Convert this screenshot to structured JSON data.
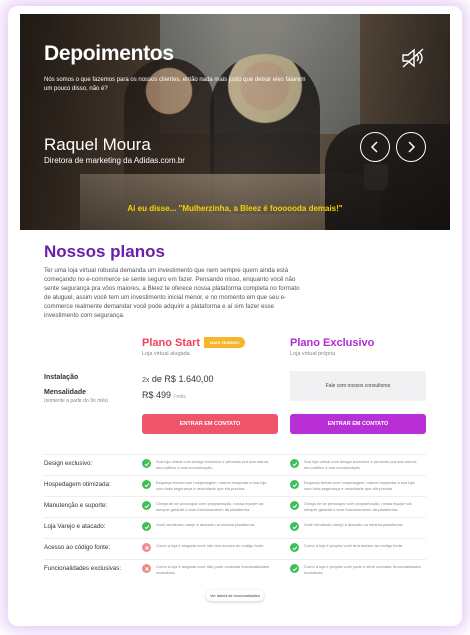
{
  "hero": {
    "title": "Depoimentos",
    "subtitle": "Nós somos o que fazemos para os nossos clientes, então nada mais justo que deixar eles falarem um pouco disso, não é?",
    "author_name": "Raquel Moura",
    "author_role": "Diretora de marketing da Adidas.com.br",
    "quote": "Ai eu disse... \"Mulherzinha, a Bleez é foooooda demais!\"",
    "icons": {
      "mute": "speaker-muted-icon",
      "prev": "chevron-left-icon",
      "next": "chevron-right-icon"
    }
  },
  "plans": {
    "title": "Nossos planos",
    "description": "Ter uma loja virtual robusta demanda um investimento que nem sempre quem ainda está começando no e-commerce se sente seguro em fazer. Pensando nisso, enquanto você não sente segurança pra vôos maiores, a Bleez te oferece nossa plataforma completa no formato de aluguel, assim você tem um investimento inicial menor, e no momento em que seu e-commerce realmente demandar você pode adquirir a plataforma e aí sim fazer esse investimento com segurança.",
    "start": {
      "name": "Plano Start",
      "badge": "MAIS VENDIDO",
      "tag": "Loja virtual alugada",
      "setup_multiplier": "2x",
      "setup_price": "de R$ 1.640,00",
      "monthly_price": "R$ 499",
      "monthly_unit": "/ mês",
      "cta": "ENTRAR EM CONTATO"
    },
    "exclusive": {
      "name": "Plano Exclusivo",
      "tag": "Loja virtual própria",
      "contact_note": "Fale com nossos consultores",
      "cta": "ENTRAR EM CONTATO"
    },
    "labels": {
      "setup": "Instalação",
      "monthly": "Mensalidade",
      "monthly_note": "(somente a partir do 3o mês)"
    },
    "features": [
      {
        "label": "Design exclusivo:",
        "start_ok": true,
        "start_text": "Sua loja virtual com design exclusivo e pensado pra sua marca, seu público e sua comunicação.",
        "excl_ok": true,
        "excl_text": "Sua loja virtual com design exclusivo e pensado pra sua marca, seu público e sua comunicação."
      },
      {
        "label": "Hospedagem otimizada:",
        "start_ok": true,
        "start_text": "Esqueça temas com hospedagem, vamos hospedar a sua loja com toda segurança e velocidade que ela precisa.",
        "excl_ok": true,
        "excl_text": "Esqueça temas com hospedagem, vamos hospedar a sua loja com toda segurança e velocidade que ela precisa."
      },
      {
        "label": "Manutenção e suporte:",
        "start_ok": true,
        "start_text": "Chega de se preocupar com programação, nossa equipe vai sempre garantir o bom funcionamento da plataforma.",
        "excl_ok": true,
        "excl_text": "Chega de se preocupar com programação, nossa equipe vai sempre garantir o bom funcionamento da plataforma."
      },
      {
        "label": "Loja Varejo e atacado:",
        "start_ok": true,
        "start_text": "Você vendendo varejo e atacado na mesma plataforma.",
        "excl_ok": true,
        "excl_text": "Você vendendo varejo e atacado na mesma plataforma."
      },
      {
        "label": "Acesso ao código fonte:",
        "start_ok": false,
        "start_text": "Como a loja é alugada você não tem acesso ao código fonte.",
        "excl_ok": true,
        "excl_text": "Como a loja é própria você terá acesso ao código fonte.",
        "excl_text_2": "Como a loja é própria você terá acesso ao código fonte."
      },
      {
        "label": "Funcionalidades exclusivas:",
        "start_ok": false,
        "start_text": "Como a loja é alugada você não pode contratar funcionalidades exclusivas.",
        "excl_ok": true,
        "excl_text": "Como a loja é própria você pode e deve contratar funcionalidades exclusivas."
      }
    ],
    "see_table": "Ver tabela de funcionalidades"
  },
  "colors": {
    "purple": "#6b1fa8",
    "start_accent": "#f05468",
    "exclusive_accent": "#b92fd6",
    "badge": "#f6b52a",
    "check": "#3fbf5b",
    "cross": "#f28a8a",
    "quote": "#f4d400"
  }
}
